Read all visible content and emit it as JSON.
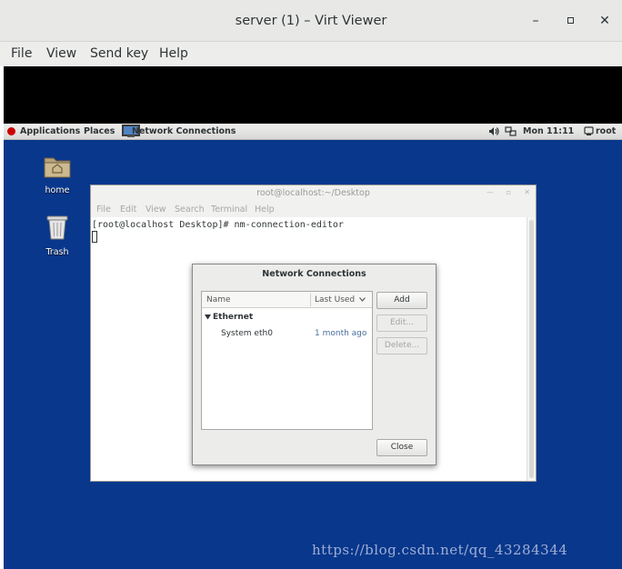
{
  "window": {
    "title": "server (1) – Virt Viewer",
    "controls": {
      "minimize": "–",
      "maximize": "▫",
      "close": "✕"
    }
  },
  "menubar": {
    "items": [
      {
        "label": "File"
      },
      {
        "label": "View"
      },
      {
        "label": "Send key"
      },
      {
        "label": "Help"
      }
    ]
  },
  "guest": {
    "topbar": {
      "applications": "Applications",
      "places": "Places",
      "task": "Network Connections",
      "clock": "Mon 11:11",
      "user": "root",
      "volume_icon": "speaker-icon",
      "network_icon": "network-icon"
    },
    "desktop_icons": [
      {
        "label": "home",
        "icon": "folder-home-icon"
      },
      {
        "label": "Trash",
        "icon": "trash-icon"
      }
    ],
    "terminal": {
      "title": "root@localhost:~/Desktop",
      "menus": [
        "File",
        "Edit",
        "View",
        "Search",
        "Terminal",
        "Help"
      ],
      "prompt_line": "[root@localhost Desktop]# nm-connection-editor"
    },
    "dialog": {
      "title": "Network Connections",
      "columns": {
        "name": "Name",
        "last_used": "Last Used"
      },
      "group": "Ethernet",
      "connections": [
        {
          "name": "System eth0",
          "last_used": "1 month ago"
        }
      ],
      "buttons": {
        "add": "Add",
        "edit": "Edit...",
        "delete": "Delete...",
        "close": "Close"
      }
    }
  },
  "watermark": "https://blog.csdn.net/qq_43284344",
  "colors": {
    "desktop": "#08378c",
    "accent_link": "#4a6e9c"
  }
}
